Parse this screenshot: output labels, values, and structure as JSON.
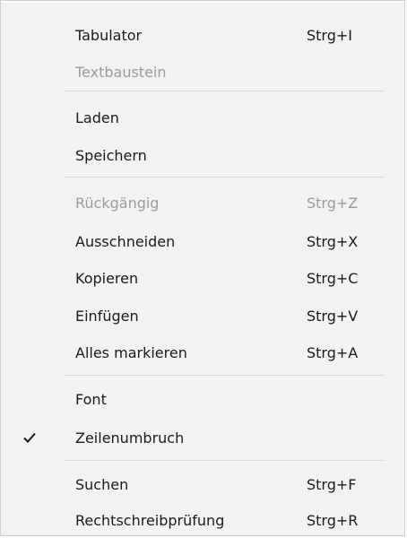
{
  "menu": {
    "items": [
      {
        "label": "Tabulator",
        "shortcut": "Strg+I"
      },
      {
        "label": "Textbaustein",
        "shortcut": ""
      },
      {
        "label": "Laden",
        "shortcut": ""
      },
      {
        "label": "Speichern",
        "shortcut": ""
      },
      {
        "label": "Rückgängig",
        "shortcut": "Strg+Z"
      },
      {
        "label": "Ausschneiden",
        "shortcut": "Strg+X"
      },
      {
        "label": "Kopieren",
        "shortcut": "Strg+C"
      },
      {
        "label": "Einfügen",
        "shortcut": "Strg+V"
      },
      {
        "label": "Alles markieren",
        "shortcut": "Strg+A"
      },
      {
        "label": "Font",
        "shortcut": ""
      },
      {
        "label": "Zeilenumbruch",
        "shortcut": "",
        "checked": true
      },
      {
        "label": "Suchen",
        "shortcut": "Strg+F"
      },
      {
        "label": "Rechtschreibprüfung",
        "shortcut": "Strg+R"
      }
    ]
  },
  "colors": {
    "menu_background": "#f2f2f2",
    "text": "#1a1a1a",
    "disabled_text": "#9b9b9b",
    "separator": "#d6d6d6"
  },
  "icons": {
    "checkmark": "checkmark-icon"
  }
}
